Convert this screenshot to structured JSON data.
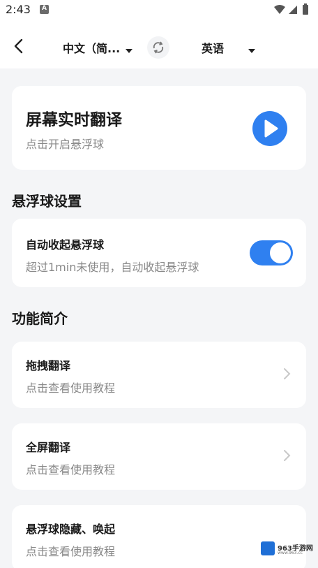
{
  "status_bar": {
    "time": "2:43",
    "notification_letter": "A"
  },
  "header": {
    "back_icon": "chevron-left-icon",
    "source_language": "中文（简...",
    "target_language": "英语",
    "swap_icon": "swap-icon"
  },
  "live_translate": {
    "title": "屏幕实时翻译",
    "subtitle": "点击开启悬浮球",
    "play_icon": "play-icon"
  },
  "float_settings": {
    "section_title": "悬浮球设置",
    "auto_collapse": {
      "title": "自动收起悬浮球",
      "subtitle": "超过1min未使用，自动收起悬浮球",
      "enabled": true
    }
  },
  "features": {
    "section_title": "功能简介",
    "items": [
      {
        "title": "拖拽翻译",
        "subtitle": "点击查看使用教程"
      },
      {
        "title": "全屏翻译",
        "subtitle": "点击查看使用教程"
      },
      {
        "title": "悬浮球隐藏、唤起",
        "subtitle": "点击查看使用教程"
      }
    ]
  },
  "watermark": {
    "text": "963手游网",
    "url": "www.963.cc"
  },
  "colors": {
    "accent": "#2f80f0",
    "background": "#f4f5f7",
    "card": "#ffffff",
    "secondary_text": "#888888"
  }
}
